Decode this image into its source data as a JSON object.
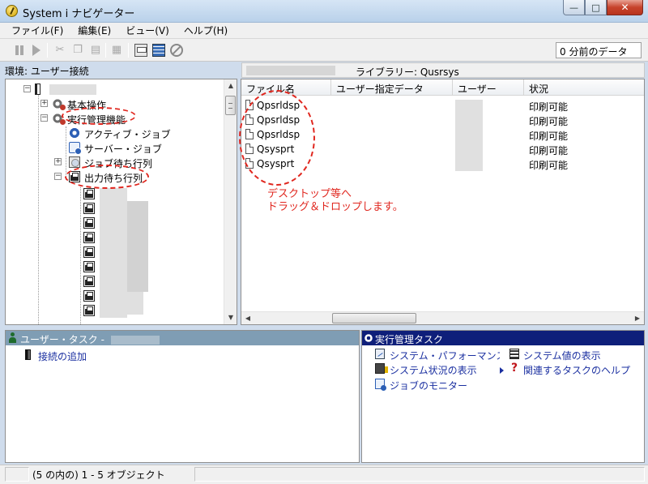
{
  "window": {
    "title": "System i ナビゲーター",
    "controls": {
      "minimize": "—",
      "maximize": "□",
      "close": "✕"
    }
  },
  "menubar": {
    "items": [
      "ファイル(F)",
      "編集(E)",
      "ビュー(V)",
      "ヘルプ(H)"
    ]
  },
  "toolbar": {
    "buttons": [
      {
        "icon": "pause-icon",
        "enabled": false
      },
      {
        "icon": "play-icon",
        "enabled": false
      },
      {
        "icon": "cut-icon",
        "enabled": false
      },
      {
        "icon": "copy-icon",
        "enabled": false
      },
      {
        "icon": "paste-icon",
        "enabled": false
      },
      {
        "icon": "properties-icon",
        "enabled": false
      },
      {
        "icon": "print-icon",
        "enabled": true
      },
      {
        "icon": "columns-icon",
        "enabled": true
      },
      {
        "icon": "stop-icon",
        "enabled": false
      }
    ],
    "data_age": "0 分前のデータ"
  },
  "environment_label": "環境: ユーザー接続",
  "library_label": "ライブラリー: Qusrsys",
  "tree": {
    "nodes": [
      {
        "label": "基本操作",
        "icon": "gear-icon",
        "expander": "+"
      },
      {
        "label": "実行管理機能",
        "icon": "gear-icon",
        "expander": "−"
      },
      {
        "label": "アクティブ・ジョブ",
        "icon": "active-job-icon"
      },
      {
        "label": "サーバー・ジョブ",
        "icon": "server-job-icon"
      },
      {
        "label": "ジョブ待ち行列",
        "icon": "job-queue-icon",
        "expander": "+"
      },
      {
        "label": "出力待ち行列",
        "icon": "output-queue-icon",
        "expander": "−"
      }
    ]
  },
  "list": {
    "columns": [
      "ファイル名",
      "ユーザー指定データ",
      "ユーザー",
      "状況"
    ],
    "rows": [
      {
        "name": "Qpsrldsp",
        "status": "印刷可能"
      },
      {
        "name": "Qpsrldsp",
        "status": "印刷可能"
      },
      {
        "name": "Qpsrldsp",
        "status": "印刷可能"
      },
      {
        "name": "Qsysprt",
        "status": "印刷可能"
      },
      {
        "name": "Qsysprt",
        "status": "印刷可能"
      }
    ]
  },
  "annotation": {
    "line1": "デスクトップ等へ",
    "line2": "ドラッグ＆ドロップします。",
    "color": "#e0271f"
  },
  "user_tasks": {
    "header": "ユーザー・タスク -",
    "items": [
      "接続の追加"
    ]
  },
  "mgmt_tasks": {
    "header": "実行管理タスク",
    "items": [
      "システム・パフォーマンス",
      "システム値の表示",
      "システム状況の表示",
      "関連するタスクのヘルプ",
      "ジョブのモニター"
    ]
  },
  "statusbar": {
    "text": "(5 の内の) 1 - 5 オブジェクト"
  },
  "colors": {
    "user_task_header": "#7f9db4",
    "mgmt_task_header": "#0e1f7a",
    "link": "#1a2fa0"
  }
}
